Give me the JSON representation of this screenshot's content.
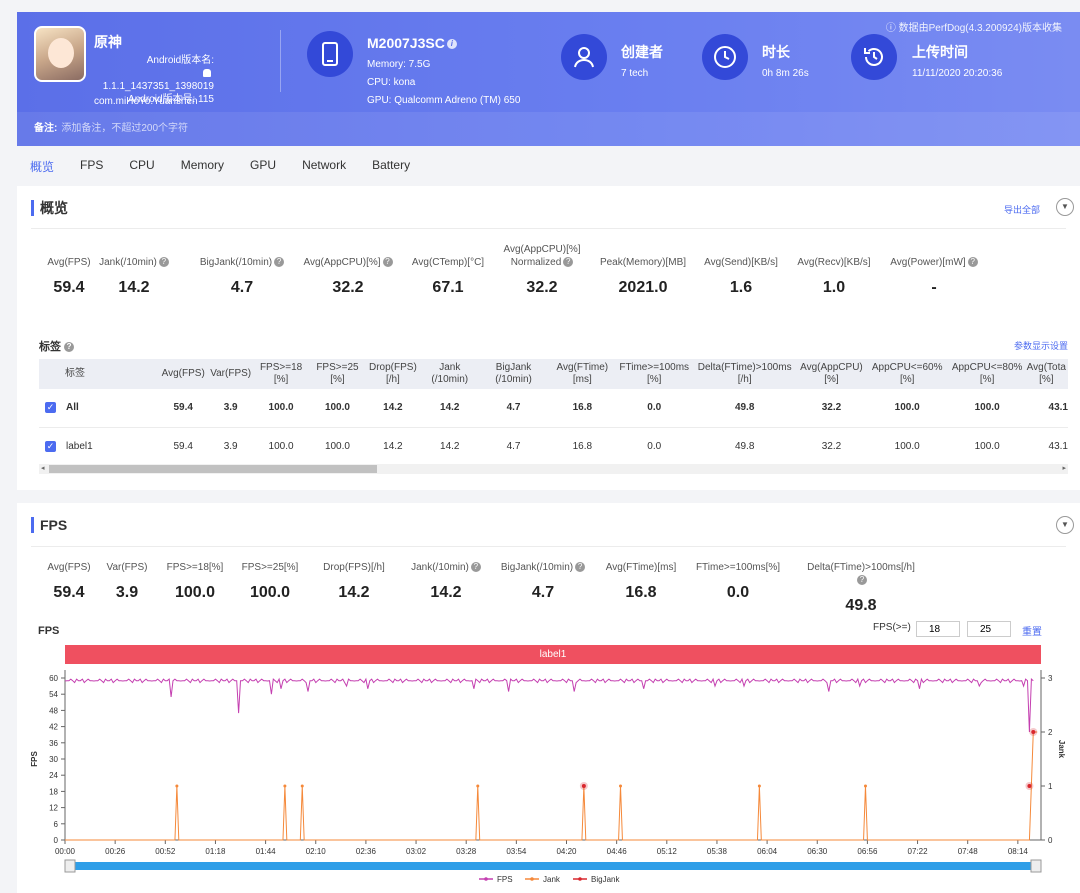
{
  "header": {
    "app_name": "原神",
    "android_label": "Android版本名:",
    "version": "1.1.1_1437351_1398019",
    "android_code": "Android版本号: 115",
    "package": "com.miHoYo.Yuanshen",
    "device": "M2007J3SC",
    "memory": "Memory: 7.5G",
    "cpu": "CPU: kona",
    "gpu": "GPU: Qualcomm Adreno (TM) 650",
    "creator_title": "创建者",
    "creator": "7 tech",
    "duration_title": "时长",
    "duration": "0h 8m 26s",
    "upload_title": "上传时间",
    "upload_time": "11/11/2020 20:20:36",
    "source": "ⓘ 数据由PerfDog(4.3.200924)版本收集",
    "note_label": "备注:",
    "note_placeholder": "添加备注，不超过200个字符"
  },
  "tabs": [
    "概览",
    "FPS",
    "CPU",
    "Memory",
    "GPU",
    "Network",
    "Battery"
  ],
  "overview": {
    "title": "概览",
    "export": "导出全部",
    "metrics": [
      {
        "label": "Avg(FPS)",
        "value": "59.4",
        "q": false
      },
      {
        "label": "Jank(/10min)",
        "value": "14.2",
        "q": true
      },
      {
        "label": "BigJank(/10min)",
        "value": "4.7",
        "q": true
      },
      {
        "label": "Avg(AppCPU)[%]",
        "value": "32.2",
        "q": true
      },
      {
        "label": "Avg(CTemp)[°C]",
        "value": "67.1",
        "q": false
      },
      {
        "label": "Avg(AppCPU)[%] Normalized",
        "value": "32.2",
        "q": true
      },
      {
        "label": "Peak(Memory)[MB]",
        "value": "2021.0",
        "q": false
      },
      {
        "label": "Avg(Send)[KB/s]",
        "value": "1.6",
        "q": false
      },
      {
        "label": "Avg(Recv)[KB/s]",
        "value": "1.0",
        "q": false
      },
      {
        "label": "Avg(Power)[mW]",
        "value": "-",
        "q": true
      }
    ],
    "tags_title": "标签",
    "settings": "参数显示设置",
    "columns": [
      "标签",
      "Avg(FPS)",
      "Var(FPS)",
      "FPS>=18 [%]",
      "FPS>=25 [%]",
      "Drop(FPS) [/h]",
      "Jank (/10min)",
      "BigJank (/10min)",
      "Avg(FTime) [ms]",
      "FTime>=100ms [%]",
      "Delta(FTime)>100ms [/h]",
      "Avg(AppCPU) [%]",
      "AppCPU<=60% [%]",
      "AppCPU<=80% [%]",
      "Avg(Tota [%]"
    ],
    "rows": [
      [
        "All",
        "59.4",
        "3.9",
        "100.0",
        "100.0",
        "14.2",
        "14.2",
        "4.7",
        "16.8",
        "0.0",
        "49.8",
        "32.2",
        "100.0",
        "100.0",
        "43.1"
      ],
      [
        "label1",
        "59.4",
        "3.9",
        "100.0",
        "100.0",
        "14.2",
        "14.2",
        "4.7",
        "16.8",
        "0.0",
        "49.8",
        "32.2",
        "100.0",
        "100.0",
        "43.1"
      ]
    ]
  },
  "fps_section": {
    "title": "FPS",
    "metrics": [
      {
        "label": "Avg(FPS)",
        "value": "59.4",
        "q": false
      },
      {
        "label": "Var(FPS)",
        "value": "3.9",
        "q": false
      },
      {
        "label": "FPS>=18[%]",
        "value": "100.0",
        "q": false
      },
      {
        "label": "FPS>=25[%]",
        "value": "100.0",
        "q": false
      },
      {
        "label": "Drop(FPS)[/h]",
        "value": "14.2",
        "q": false
      },
      {
        "label": "Jank(/10min)",
        "value": "14.2",
        "q": true
      },
      {
        "label": "BigJank(/10min)",
        "value": "4.7",
        "q": true
      },
      {
        "label": "Avg(FTime)[ms]",
        "value": "16.8",
        "q": false
      },
      {
        "label": "FTime>=100ms[%]",
        "value": "0.0",
        "q": false
      },
      {
        "label": "Delta(FTime)>100ms[/h]",
        "value": "49.8",
        "q": true
      }
    ],
    "chart_label": "FPS",
    "fps_threshold_label": "FPS(>=)",
    "fps_threshold_1": "18",
    "fps_threshold_2": "25",
    "reset": "重置",
    "label_bar": "label1"
  },
  "chart_data": {
    "type": "line",
    "ylabel": "FPS",
    "y2label": "Jank",
    "ylim": [
      0,
      60
    ],
    "y2lim": [
      0,
      3
    ],
    "yticks": [
      0,
      6,
      12,
      18,
      24,
      30,
      36,
      42,
      48,
      54,
      60
    ],
    "y2ticks": [
      0,
      1,
      2,
      3
    ],
    "xticks": [
      "00:00",
      "00:26",
      "00:52",
      "01:18",
      "01:44",
      "02:10",
      "02:36",
      "03:02",
      "03:28",
      "03:54",
      "04:20",
      "04:46",
      "05:12",
      "05:38",
      "06:04",
      "06:30",
      "06:56",
      "07:22",
      "07:48",
      "08:14"
    ],
    "x_max_seconds": 506,
    "fps_base": 59,
    "fps_dips": [
      [
        55,
        53
      ],
      [
        90,
        47
      ],
      [
        107,
        54
      ],
      [
        112,
        56
      ],
      [
        126,
        55
      ],
      [
        146,
        57
      ],
      [
        157,
        56
      ],
      [
        212,
        56
      ],
      [
        230,
        55
      ],
      [
        264,
        55
      ],
      [
        300,
        56
      ],
      [
        337,
        57
      ],
      [
        352,
        57
      ],
      [
        396,
        55
      ],
      [
        412,
        57
      ],
      [
        443,
        56
      ],
      [
        474,
        57
      ],
      [
        497,
        57
      ],
      [
        500,
        40
      ],
      [
        503,
        30
      ]
    ],
    "jank_times": [
      58,
      114,
      123,
      214,
      269,
      288,
      360,
      415
    ],
    "bigjank_times": [
      269,
      500
    ],
    "jank_end": [
      504,
      2
    ],
    "legend": [
      "FPS",
      "Jank",
      "BigJank"
    ],
    "colors": {
      "fps": "#c43fb0",
      "jank": "#f5893a",
      "bigjank": "#d9272e"
    }
  }
}
